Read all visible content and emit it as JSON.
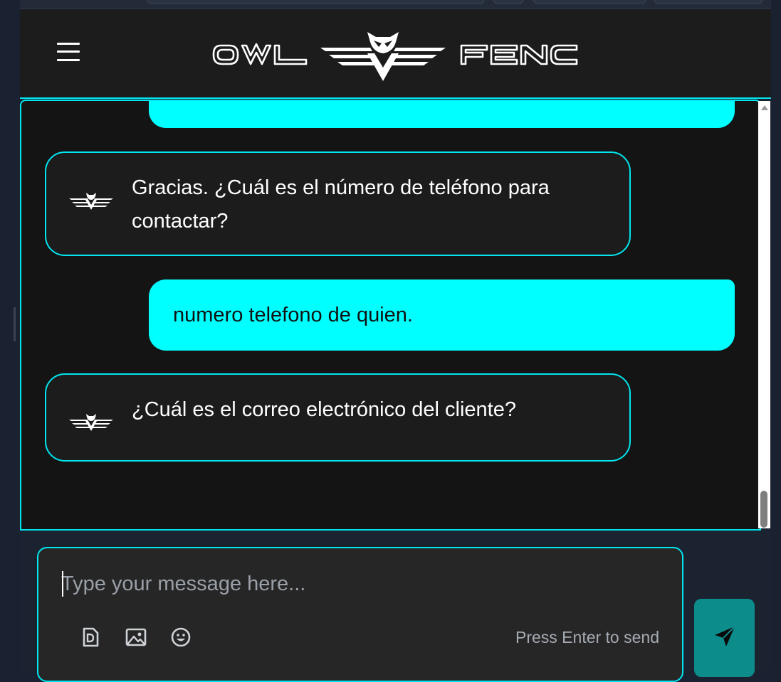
{
  "header": {
    "brand_left": "OWL",
    "brand_right": "FENC",
    "menu_icon": "hamburger-menu-icon"
  },
  "messages": [
    {
      "role": "user",
      "text": "",
      "partial": true
    },
    {
      "role": "bot",
      "text": "Gracias. ¿Cuál es el número de teléfono para contactar?"
    },
    {
      "role": "user",
      "text": "numero telefono de quien."
    },
    {
      "role": "bot",
      "text": "¿Cuál es el correo electrónico del cliente?"
    }
  ],
  "composer": {
    "placeholder": "Type your message here...",
    "value": "",
    "hint": "Press Enter to send",
    "tools": [
      "document-icon",
      "image-icon",
      "emoji-icon"
    ]
  },
  "send": {
    "icon": "send-icon"
  },
  "colors": {
    "accent": "#00e5ee",
    "user_bubble": "#00ffff",
    "bot_bubble": "#1c1c1c",
    "chat_background": "#141414",
    "send_button": "#0d8c8c"
  }
}
